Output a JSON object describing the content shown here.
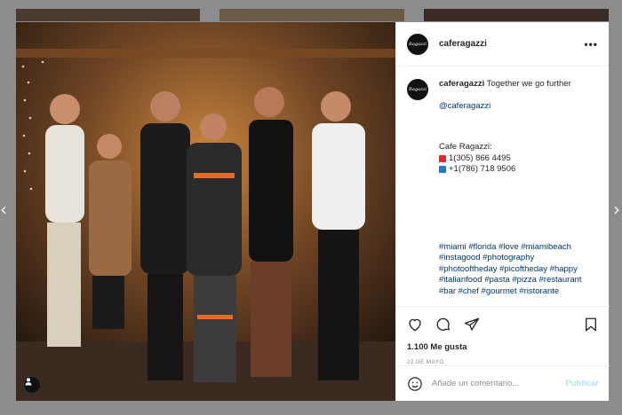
{
  "background": {
    "color": "#8c8c8c"
  },
  "nav": {
    "prev_glyph": "‹",
    "next_glyph": "›"
  },
  "post": {
    "avatar_text": "Ragazzi",
    "username": "caferagazzi",
    "more_glyph": "•••",
    "caption_text": "Together we go further",
    "mention": "@caferagazzi",
    "contact_title": "Cafe Ragazzi:",
    "phones": [
      {
        "icon": "phone-red-icon",
        "color": "#d32f2f",
        "number": "1(305) 866 4495"
      },
      {
        "icon": "phone-blue-icon",
        "color": "#2a78c7",
        "number": "+1(786) 718 9506"
      }
    ],
    "hashtags": [
      "#miami #florida #love #miamibeach",
      "#instagood #photography",
      "#photooftheday #picoftheday #happy",
      "#italianfood #pasta #pizza #restaurant",
      "#bar #chef #gourmet #ristorante"
    ],
    "likes": "1.100 Me gusta",
    "date": "22 DE MAYO",
    "comment_placeholder": "Añade un comentario...",
    "publish_label": "Publicar"
  },
  "icons": {
    "like": "heart-icon",
    "comment": "comment-icon",
    "share": "share-icon",
    "save": "bookmark-icon",
    "emoji": "emoji-icon",
    "user_tag": "user-tag-icon"
  }
}
